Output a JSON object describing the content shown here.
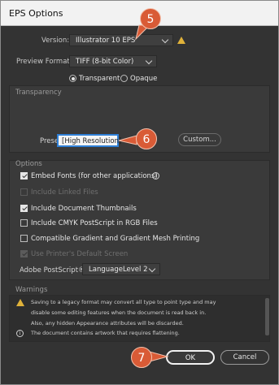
{
  "dialog": {
    "title": "EPS Options"
  },
  "version": {
    "label": "Version:",
    "value": "Illustrator 10 EPS"
  },
  "preview_format": {
    "label": "Preview Format:",
    "value": "TIFF (8-bit Color)"
  },
  "background": {
    "transparent": "Transparent",
    "opaque": "Opaque"
  },
  "transparency": {
    "heading": "Transparency",
    "preset_label": "Preset:",
    "preset_value": "[High Resolution]",
    "custom_button": "Custom..."
  },
  "options": {
    "heading": "Options",
    "items": [
      {
        "label": "Embed Fonts (for other applications)",
        "checked": true,
        "enabled": true
      },
      {
        "label": "Include Linked Files",
        "checked": false,
        "enabled": false
      },
      {
        "label": "Include Document Thumbnails",
        "checked": true,
        "enabled": true
      },
      {
        "label": "Include CMYK PostScript in RGB Files",
        "checked": false,
        "enabled": true
      },
      {
        "label": "Compatible Gradient and Gradient Mesh Printing",
        "checked": false,
        "enabled": true
      },
      {
        "label": "Use Printer's Default Screen",
        "checked": true,
        "enabled": false
      }
    ],
    "postscript_label": "Adobe PostScript®:",
    "postscript_value": "LanguageLevel 2"
  },
  "warnings": {
    "heading": "Warnings",
    "lines": [
      "Saving to a legacy format may convert all type to point type and may",
      "disable some editing features when the document is read back in.",
      "Also, any hidden Appearance attributes will be discarded.",
      "The document contains artwork that requires flattening."
    ]
  },
  "buttons": {
    "ok": "OK",
    "cancel": "Cancel"
  },
  "callouts": {
    "step5": "5",
    "step6": "6",
    "step7": "7"
  },
  "colors": {
    "callout": "#d95b36",
    "warning": "#e0b23a",
    "focus": "#2f7fd6"
  }
}
